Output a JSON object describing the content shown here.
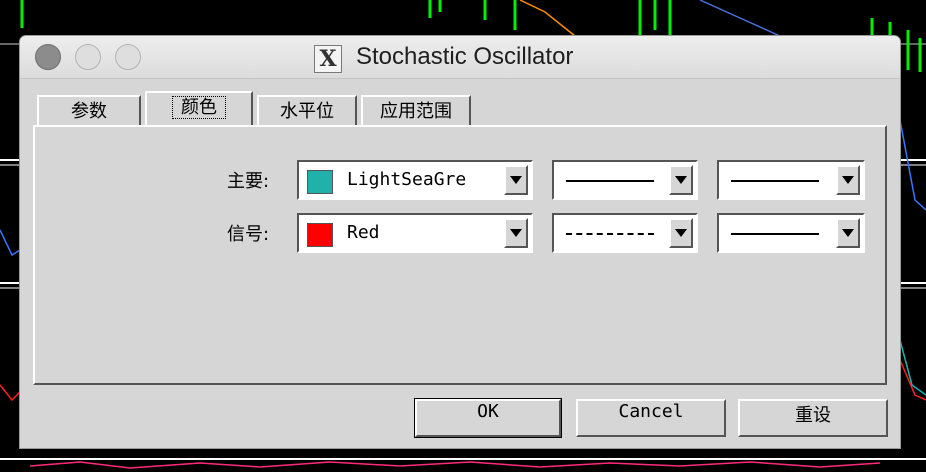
{
  "window": {
    "title": "Stochastic Oscillator"
  },
  "tabs": [
    {
      "label": "参数"
    },
    {
      "label": "颜色",
      "active": true
    },
    {
      "label": "水平位"
    },
    {
      "label": "应用范围"
    }
  ],
  "rows": [
    {
      "label": "主要:",
      "color_name": "LightSeaGre",
      "color_hex": "#20b2aa",
      "style": "solid",
      "width": "solid"
    },
    {
      "label": "信号:",
      "color_name": "Red",
      "color_hex": "#ff0000",
      "style": "dashed",
      "width": "solid"
    }
  ],
  "buttons": {
    "ok": "OK",
    "cancel": "Cancel",
    "reset": "重设"
  },
  "icons": {
    "app": "x-window-icon",
    "dropdown": "chevron-down-icon"
  }
}
